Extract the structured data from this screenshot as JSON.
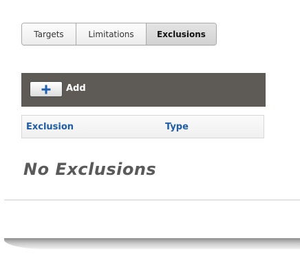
{
  "tabs": [
    {
      "label": "Targets",
      "active": false
    },
    {
      "label": "Limitations",
      "active": false
    },
    {
      "label": "Exclusions",
      "active": true
    }
  ],
  "toolbar": {
    "add_label": "Add",
    "add_icon": "plus-icon",
    "background": "#5e5a56"
  },
  "table": {
    "columns": [
      "Exclusion",
      "Type"
    ],
    "header_color": "#1e5da8"
  },
  "empty_state": "No Exclusions"
}
